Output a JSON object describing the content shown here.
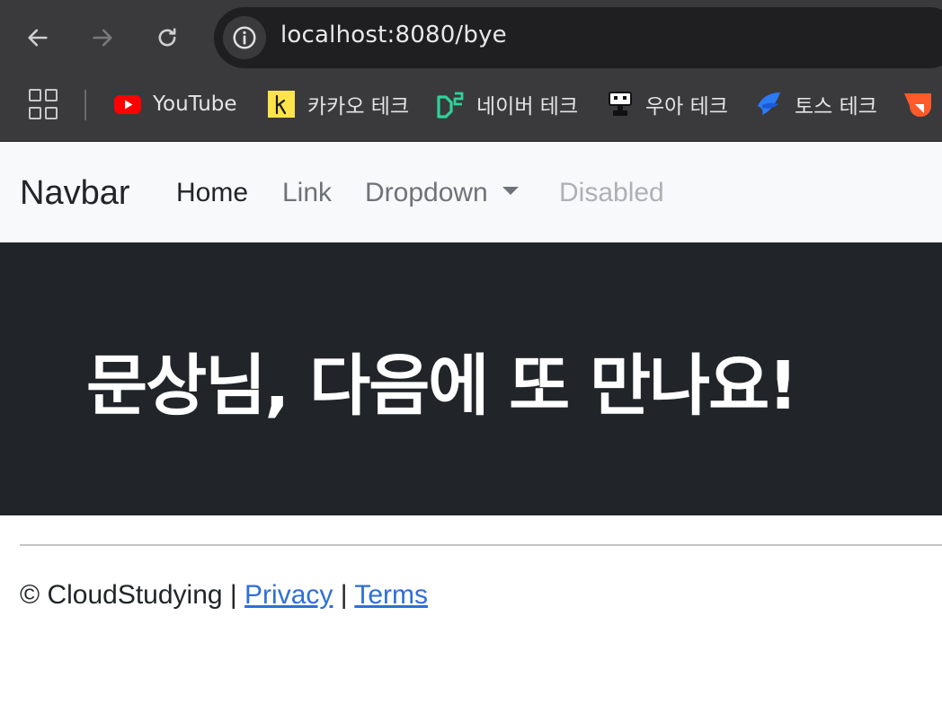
{
  "browser": {
    "url": "localhost:8080/bye",
    "bookmarks": [
      {
        "label": "YouTube",
        "icon": "youtube-icon"
      },
      {
        "label": "카카오 테크",
        "icon": "kakao-tech-icon"
      },
      {
        "label": "네이버 테크",
        "icon": "naver-d2-icon"
      },
      {
        "label": "우아 테크",
        "icon": "woowa-icon"
      },
      {
        "label": "토스 테크",
        "icon": "toss-icon"
      }
    ]
  },
  "navbar": {
    "brand": "Navbar",
    "links": {
      "home": "Home",
      "link": "Link",
      "dropdown": "Dropdown",
      "disabled": "Disabled"
    }
  },
  "hero": {
    "title": "문상님, 다음에 또 만나요!"
  },
  "footer": {
    "copyright": "© CloudStudying",
    "separator1": " | ",
    "privacy": "Privacy",
    "separator2": " | ",
    "terms": "Terms"
  },
  "colors": {
    "chrome": "#3a3a3c",
    "navbar_bg": "#f8f9fa",
    "hero_bg": "#212529",
    "link": "#2f6fd6"
  }
}
